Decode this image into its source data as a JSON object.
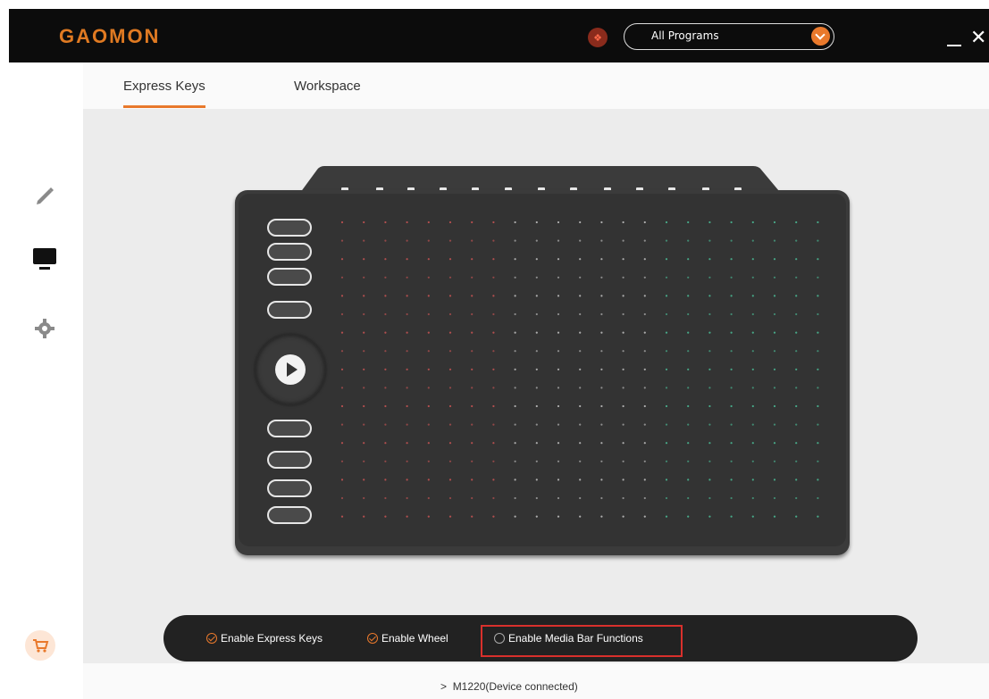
{
  "app": {
    "logo": "GAOMON",
    "brand_color": "#e9792c"
  },
  "header": {
    "program_select": {
      "value": "All Programs"
    },
    "minimize_glyph": "—",
    "close_glyph": "✕"
  },
  "sidebar": {
    "items": [
      "pen-icon",
      "display-icon",
      "gear-icon"
    ],
    "cart": "cart-icon"
  },
  "tabs": [
    {
      "label": "Express Keys",
      "active": true
    },
    {
      "label": "Workspace",
      "active": false
    }
  ],
  "options": [
    {
      "label": "Enable Express Keys",
      "checked": true
    },
    {
      "label": "Enable Wheel",
      "checked": true
    },
    {
      "label": "Enable Media Bar Functions",
      "checked": false
    }
  ],
  "status": {
    "device": "M1220(Device connected)",
    "chevron": ">"
  }
}
